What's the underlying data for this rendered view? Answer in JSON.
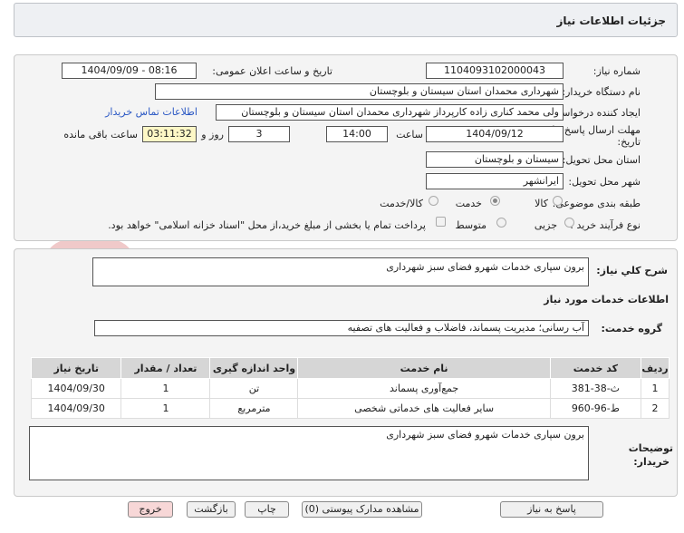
{
  "header": {
    "title": "جزئیات اطلاعات نیاز"
  },
  "form": {
    "need_number_label": "شماره نیاز:",
    "need_number": "1104093102000043",
    "announce_label": "تاریخ و ساعت اعلان عمومی:",
    "announce_value": "1404/09/09 - 08:16",
    "buyer_label": "نام دستگاه خریدار:",
    "buyer_value": "شهرداری محمدان استان سیستان و بلوچستان",
    "creator_label": "ایجاد کننده درخواست:",
    "creator_value": "ولی محمد کناری زاده کارپرداز شهرداری محمدان استان سیستان و بلوچستان",
    "contact_link": "اطلاعات تماس خریدار",
    "deadline_label_1": "مهلت ارسال پاسخ: تا",
    "deadline_label_2": "تاریخ:",
    "deadline_date": "1404/09/12",
    "time_label": "ساعت",
    "deadline_time": "14:00",
    "days_value": "3",
    "days_label": "روز و",
    "remaining_value": "03:11:32",
    "remaining_label": "ساعت باقی مانده",
    "province_label": "استان محل تحویل:",
    "province_value": "سیستان و بلوچستان",
    "city_label": "شهر محل تحویل:",
    "city_value": "ایرانشهر",
    "category_label": "طبقه بندی موضوعی:",
    "category_options": [
      "کالا",
      "خدمت",
      "کالا/خدمت"
    ],
    "category_selected": "خدمت",
    "process_label": "نوع فرآیند خرید :",
    "process_options": [
      "جزیی",
      "متوسط"
    ],
    "process_selected": "",
    "payment_note": "پرداخت تمام یا بخشی از مبلغ خرید،از محل \"اسناد خزانه اسلامی\" خواهد بود."
  },
  "description": {
    "label": "شرح کلي نياز:",
    "value": "برون سپاری خدمات شهرو فضای سبز شهرداری"
  },
  "services": {
    "section_title": "اطلاعات خدمات مورد نیاز",
    "group_label": "گروه خدمت:",
    "group_value": "آب رسانی؛ مدیریت پسماند، فاضلاب و فعالیت های تصفیه",
    "columns": [
      "ردیف",
      "کد خدمت",
      "نام خدمت",
      "واحد اندازه گیری",
      "تعداد / مقدار",
      "تاریخ نیاز"
    ],
    "rows": [
      [
        "1",
        "ث-38-381",
        "جمع‌آوری پسماند",
        "تن",
        "1",
        "1404/09/30"
      ],
      [
        "2",
        "ط-96-960",
        "سایر فعالیت های خدماتی شخصی",
        "مترمربع",
        "1",
        "1404/09/30"
      ]
    ]
  },
  "buyer_notes": {
    "label_1": "توضیحات",
    "label_2": "خریدار:",
    "value": "برون سپاری خدمات شهرو فضای سبز شهرداری"
  },
  "buttons": {
    "reply": "پاسخ به نیاز",
    "attachments": "مشاهده مدارک پیوستی (0)",
    "print": "چاپ",
    "back": "بازگشت",
    "exit": "خروج"
  },
  "watermark": {
    "text": "AriaTender.net"
  },
  "colors": {
    "link": "#2b58c4",
    "exit_button": "#f7d7d7",
    "remaining_bg": "#fdf7c6"
  }
}
